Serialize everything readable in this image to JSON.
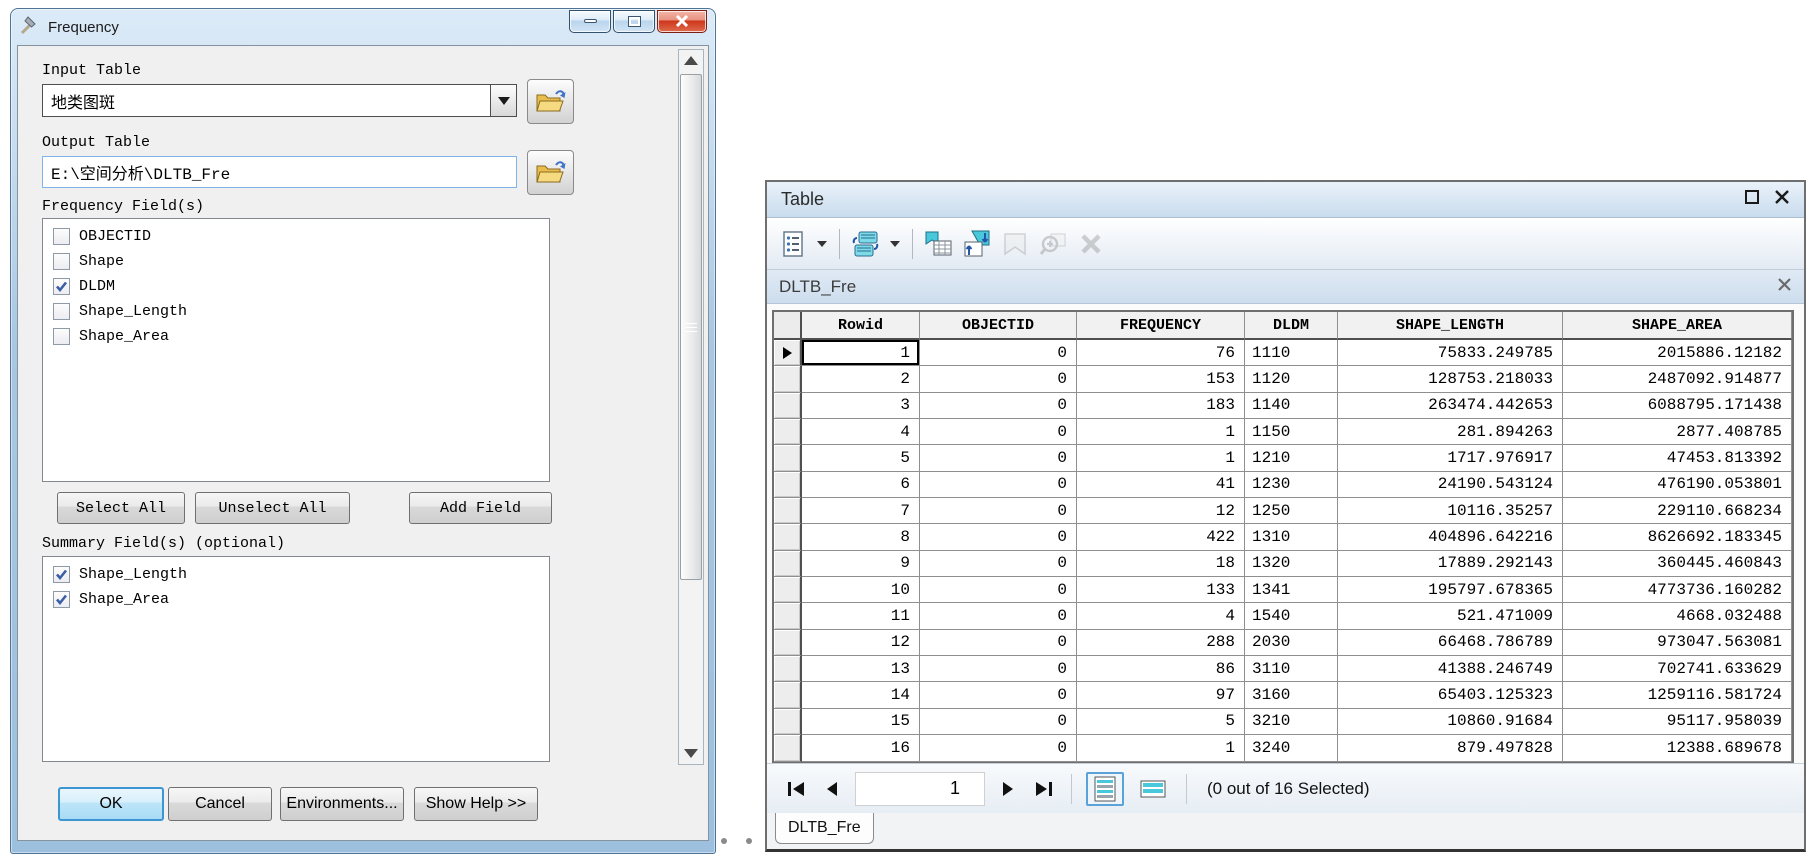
{
  "frequency_dialog": {
    "title": "Frequency",
    "input_table_label": "Input Table",
    "input_table_value": "地类图斑",
    "output_table_label": "Output Table",
    "output_table_value": "E:\\空间分析\\DLTB_Fre",
    "frequency_fields_label": "Frequency Field(s)",
    "frequency_fields": [
      {
        "label": "OBJECTID",
        "checked": false
      },
      {
        "label": "Shape",
        "checked": false
      },
      {
        "label": "DLDM",
        "checked": true
      },
      {
        "label": "Shape_Length",
        "checked": false
      },
      {
        "label": "Shape_Area",
        "checked": false
      }
    ],
    "select_all_label": "Select All",
    "unselect_all_label": "Unselect All",
    "add_field_label": "Add Field",
    "summary_fields_label": "Summary Field(s) (optional)",
    "summary_fields": [
      {
        "label": "Shape_Length",
        "checked": true
      },
      {
        "label": "Shape_Area",
        "checked": true
      }
    ],
    "ok_label": "OK",
    "cancel_label": "Cancel",
    "environments_label": "Environments...",
    "show_help_label": "Show Help >>"
  },
  "table_window": {
    "title": "Table",
    "layer_title": "DLTB_Fre",
    "columns": [
      "Rowid",
      "OBJECTID",
      "FREQUENCY",
      "DLDM",
      "SHAPE_LENGTH",
      "SHAPE_AREA"
    ],
    "rows": [
      [
        "1",
        "0",
        "76",
        "1110",
        "75833.249785",
        "2015886.12182"
      ],
      [
        "2",
        "0",
        "153",
        "1120",
        "128753.218033",
        "2487092.914877"
      ],
      [
        "3",
        "0",
        "183",
        "1140",
        "263474.442653",
        "6088795.171438"
      ],
      [
        "4",
        "0",
        "1",
        "1150",
        "281.894263",
        "2877.408785"
      ],
      [
        "5",
        "0",
        "1",
        "1210",
        "1717.976917",
        "47453.813392"
      ],
      [
        "6",
        "0",
        "41",
        "1230",
        "24190.543124",
        "476190.053801"
      ],
      [
        "7",
        "0",
        "12",
        "1250",
        "10116.35257",
        "229110.668234"
      ],
      [
        "8",
        "0",
        "422",
        "1310",
        "404896.642216",
        "8626692.183345"
      ],
      [
        "9",
        "0",
        "18",
        "1320",
        "17889.292143",
        "360445.460843"
      ],
      [
        "10",
        "0",
        "133",
        "1341",
        "195797.678365",
        "4773736.160282"
      ],
      [
        "11",
        "0",
        "4",
        "1540",
        "521.471009",
        "4668.032488"
      ],
      [
        "12",
        "0",
        "288",
        "2030",
        "66468.786789",
        "973047.563081"
      ],
      [
        "13",
        "0",
        "86",
        "3110",
        "41388.246749",
        "702741.633629"
      ],
      [
        "14",
        "0",
        "97",
        "3160",
        "65403.125323",
        "1259116.581724"
      ],
      [
        "15",
        "0",
        "5",
        "3210",
        "10860.91684",
        "95117.958039"
      ],
      [
        "16",
        "0",
        "1",
        "3240",
        "879.497828",
        "12388.689678"
      ]
    ],
    "page_value": "1",
    "status_text": "(0 out of 16 Selected)",
    "tab_label": "DLTB_Fre",
    "toolbar_icons": [
      "table-options-icon",
      "related-tables-icon",
      "select-by-attributes-icon",
      "switch-selection-icon",
      "clear-selection-icon",
      "zoom-to-selected-icon",
      "delete-selected-icon"
    ],
    "colors": {
      "selection_cyan": "#49c8dc",
      "aero_blue": "#a9c7e2"
    }
  }
}
